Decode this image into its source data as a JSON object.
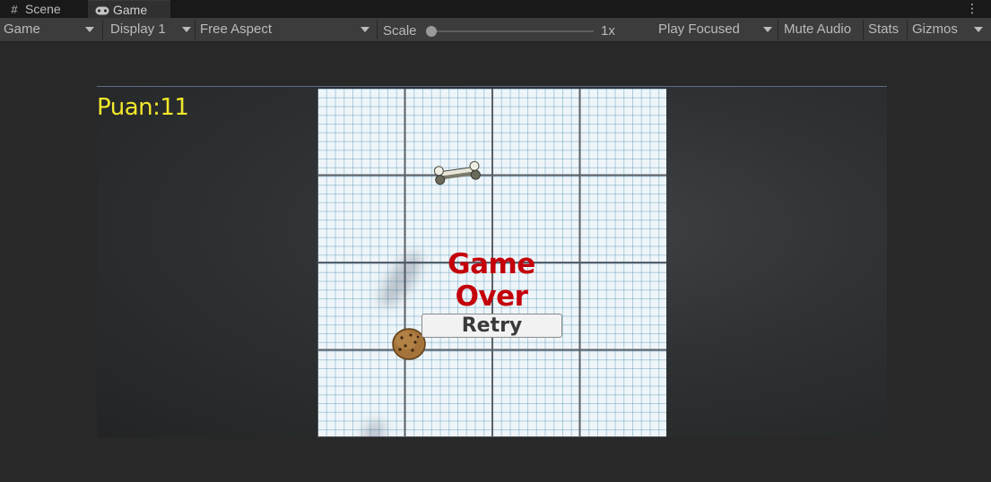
{
  "tabs": [
    {
      "label": "Scene",
      "icon": "grid-icon",
      "active": false
    },
    {
      "label": "Game",
      "icon": "gamepad-icon",
      "active": true
    }
  ],
  "toolbar": {
    "display_mode": "Game",
    "display": "Display 1",
    "aspect": "Free Aspect",
    "scale_label": "Scale",
    "scale_value": "1x",
    "play_mode": "Play Focused",
    "mute_audio": "Mute Audio",
    "stats": "Stats",
    "gizmos": "Gizmos"
  },
  "game": {
    "score_text": "Puan:11",
    "game_over_text": "Game Over",
    "retry_label": "Retry"
  },
  "colors": {
    "score": "#f2e82a",
    "game_over": "#c4000a",
    "toolbar_bg": "#3c3c3c",
    "tab_bg": "#191919"
  }
}
